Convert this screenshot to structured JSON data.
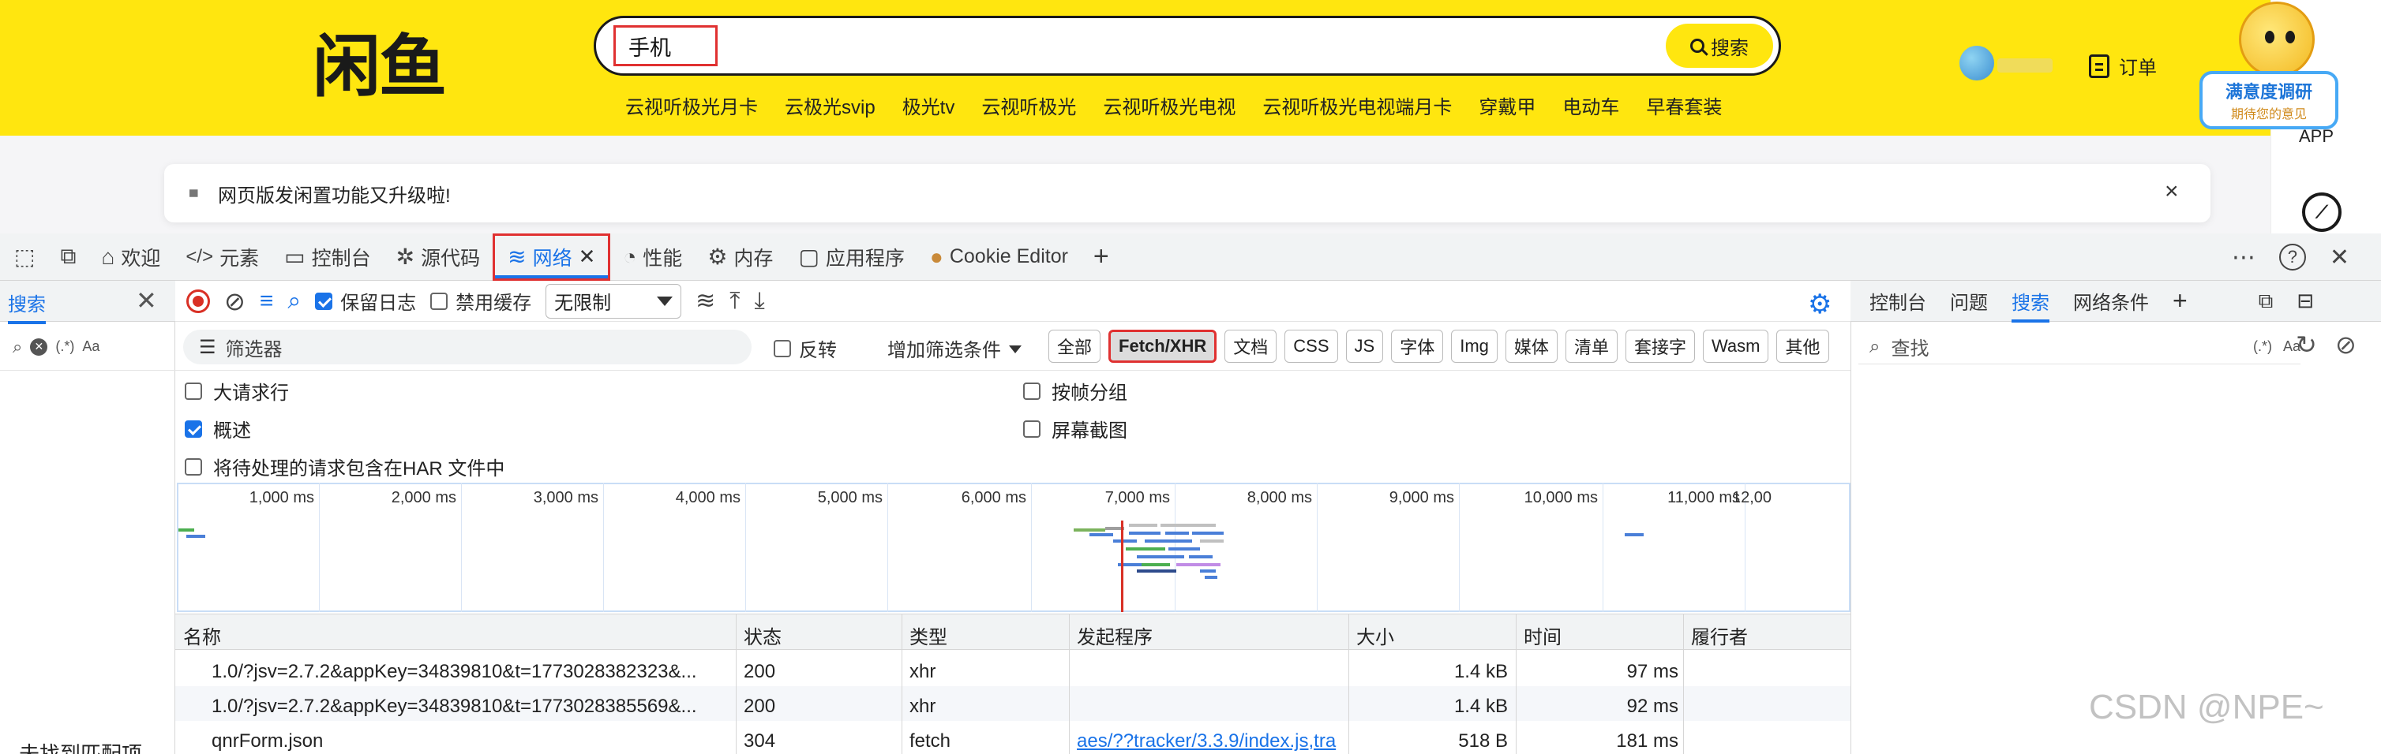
{
  "site": {
    "logo_text": "闲鱼",
    "search_query": "手机",
    "search_button": "搜索",
    "hot_words": [
      "云视听极光月卡",
      "云极光svip",
      "极光tv",
      "云视听极光",
      "云视听极光电视",
      "云视听极光电视端月卡",
      "穿戴甲",
      "电动车",
      "早春套装"
    ],
    "orders_label": "订单",
    "app_label": "APP",
    "survey_title": "满意度调研",
    "survey_subtitle": "期待您的意见",
    "notice": "网页版发闲置功能又升级啦!",
    "notice_close": "×"
  },
  "devtools": {
    "tabs": [
      {
        "icon": "⌂",
        "label": "欢迎"
      },
      {
        "icon": "</>",
        "label": "元素"
      },
      {
        "icon": "▭",
        "label": "控制台"
      },
      {
        "icon": "✲",
        "label": "源代码"
      },
      {
        "icon": "≋",
        "label": "网络"
      },
      {
        "icon": "◔",
        "label": "性能"
      },
      {
        "icon": "⚙",
        "label": "内存"
      },
      {
        "icon": "▢",
        "label": "应用程序"
      },
      {
        "icon": "●",
        "label": "Cookie Editor"
      }
    ],
    "add_tab": "+",
    "more": "⋯",
    "help": "?",
    "close": "✕",
    "left_drawer": {
      "tab": "搜索",
      "close": "✕",
      "regex": "(.*)",
      "case": "Aa",
      "result_text": "未找到匹配项"
    },
    "toolbar": {
      "preserve_log": "保留日志",
      "disable_cache": "禁用缓存",
      "throttle": "无限制"
    },
    "filter": {
      "placeholder": "筛选器",
      "invert": "反转",
      "more_filters": "增加筛选条件",
      "types": [
        "全部",
        "Fetch/XHR",
        "文档",
        "CSS",
        "JS",
        "字体",
        "Img",
        "媒体",
        "清单",
        "套接字",
        "Wasm",
        "其他"
      ],
      "selected_type": "Fetch/XHR"
    },
    "options": {
      "large_rows": "大请求行",
      "group_by_frame": "按帧分组",
      "overview": "概述",
      "screenshots": "屏幕截图",
      "har_pending": "将待处理的请求包含在HAR 文件中"
    },
    "timeline_ticks": [
      "1,000 ms",
      "2,000 ms",
      "3,000 ms",
      "4,000 ms",
      "5,000 ms",
      "6,000 ms",
      "7,000 ms",
      "8,000 ms",
      "9,000 ms",
      "10,000 ms",
      "11,000 ms",
      "12,00"
    ],
    "table": {
      "columns": [
        "名称",
        "状态",
        "类型",
        "发起程序",
        "大小",
        "时间",
        "履行者"
      ],
      "rows": [
        {
          "name": "1.0/?jsv=2.7.2&appKey=34839810&t=1773028382323&...",
          "status": "200",
          "type": "xhr",
          "initiator": "",
          "size": "1.4 kB",
          "time": "97 ms"
        },
        {
          "name": "1.0/?jsv=2.7.2&appKey=34839810&t=1773028385569&...",
          "status": "200",
          "type": "xhr",
          "initiator": "",
          "size": "1.4 kB",
          "time": "92 ms"
        },
        {
          "name": "qnrForm.json",
          "status": "304",
          "type": "fetch",
          "initiator": "aes/??tracker/3.3.9/index.js,tra",
          "size": "518 B",
          "time": "181 ms"
        }
      ]
    },
    "right_drawer": {
      "tabs": [
        "控制台",
        "问题",
        "搜索",
        "网络条件"
      ],
      "active_tab": "搜索",
      "find_placeholder": "查找",
      "regex": "(.*)",
      "case": "Aa"
    }
  },
  "watermark": "CSDN @NPE~",
  "colors": {
    "brand_yellow": "#ffe60f",
    "accent_blue": "#1a73e8",
    "highlight_red": "#e03131"
  }
}
